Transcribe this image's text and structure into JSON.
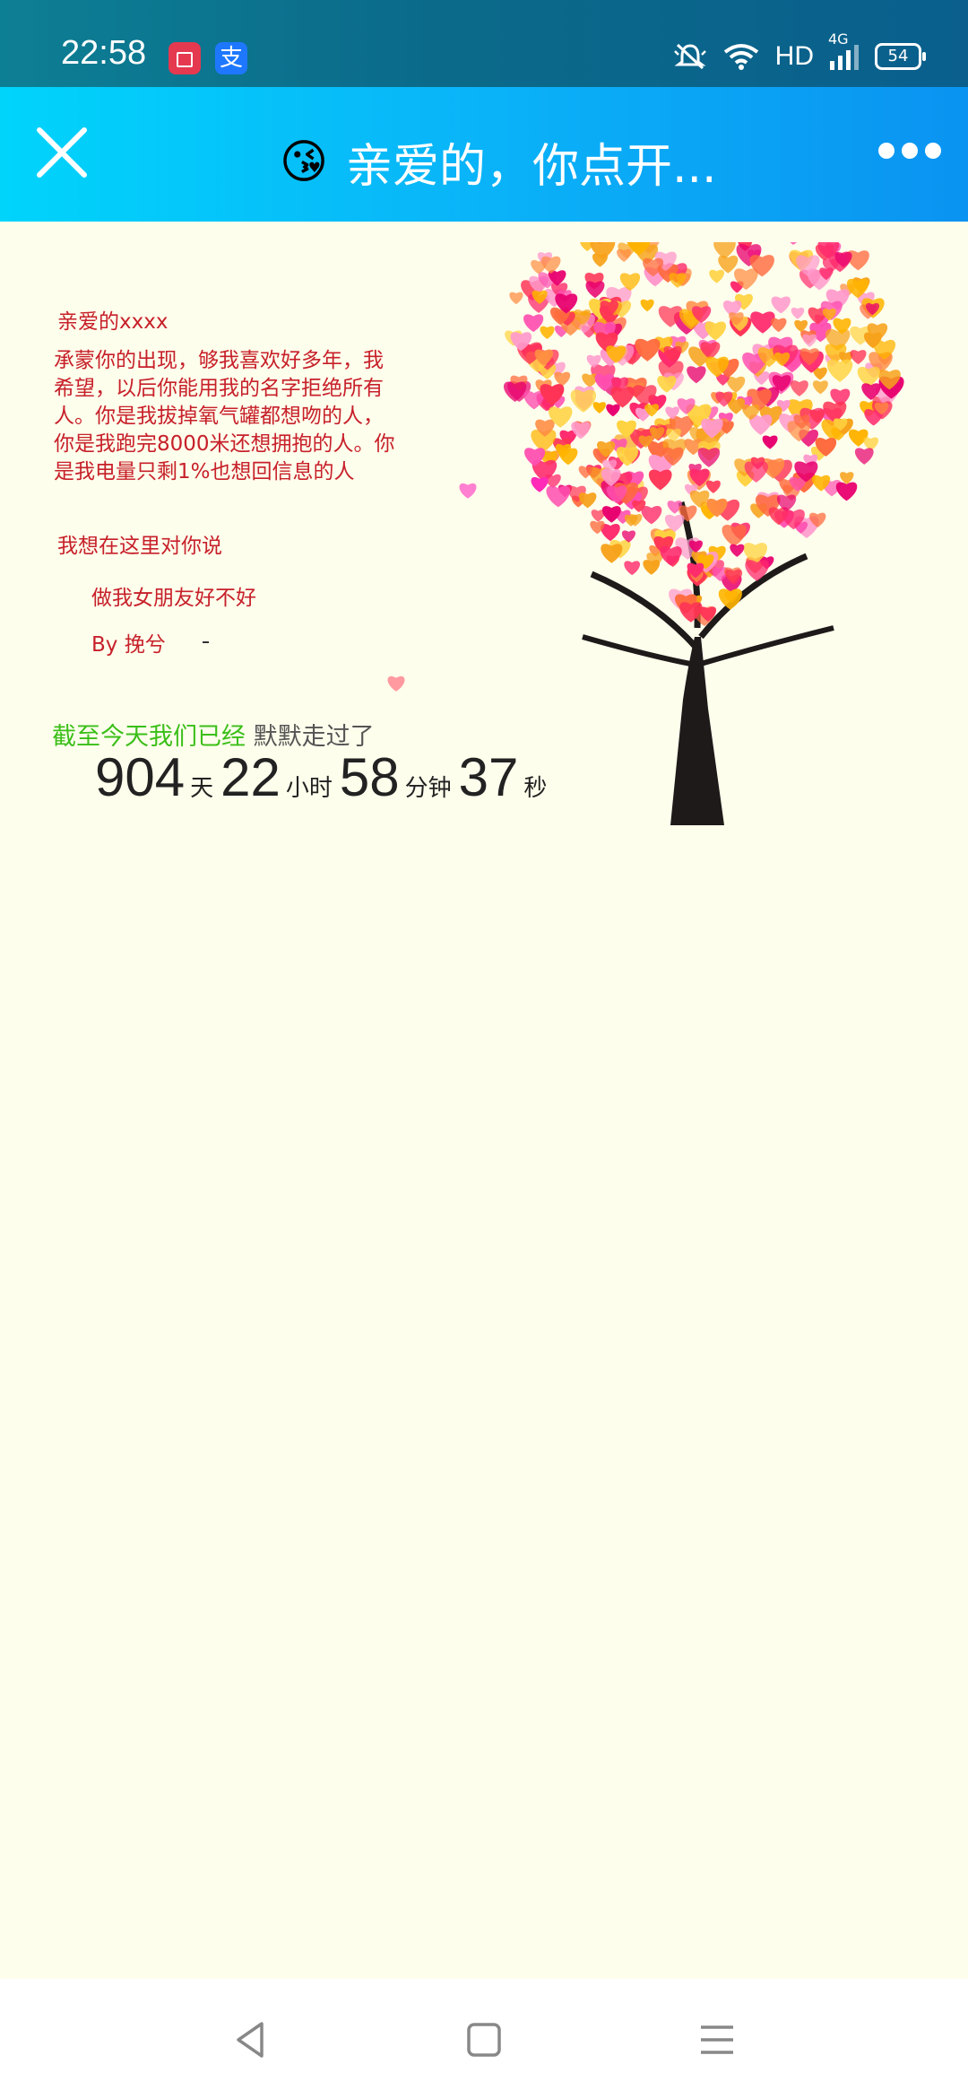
{
  "status_bar": {
    "time": "22:58",
    "app_icons": [
      "screen-recorder-icon",
      "alipay-icon"
    ],
    "network": "HD",
    "network_type": "4G",
    "battery": "54"
  },
  "title_bar": {
    "close_icon": "close-icon",
    "emoji": "😘",
    "title": "亲爱的，你点开...",
    "more_icon": "more-icon"
  },
  "letter": {
    "greeting": "亲爱的xxxx",
    "paragraph": "承蒙你的出现，够我喜欢好多年，我希望，以后你能用我的名字拒绝所有人。你是我拔掉氧气罐都想吻的人，你是我跑完8000米还想拥抱的人。你是我电量只剩1%也想回信息的人",
    "wish": "我想在这里对你说",
    "question": "做我女朋友好不好",
    "signature": "By 挽兮"
  },
  "timer": {
    "prefix": "截至今天我们已经",
    "suffix": "默默走过了",
    "days": "904",
    "days_unit": "天",
    "hours": "22",
    "hours_unit": "小时",
    "minutes": "58",
    "minutes_unit": "分钟",
    "seconds": "37",
    "seconds_unit": "秒"
  },
  "colors": {
    "background": "#fefeec",
    "letter_text": "#c7202a",
    "green_text": "#3abf18",
    "title_gradient_start": "#00d4fb",
    "title_gradient_end": "#0a93f1"
  },
  "nav_bar": {
    "back_icon": "back-icon",
    "home_icon": "home-icon",
    "menu_icon": "menu-icon"
  }
}
